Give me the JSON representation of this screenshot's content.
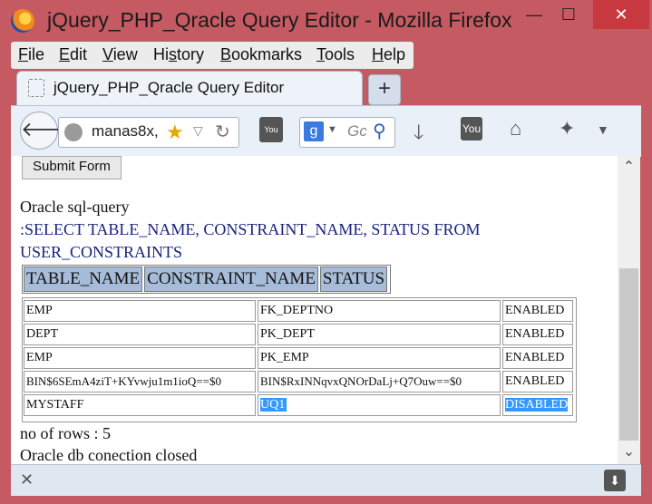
{
  "window": {
    "title": "jQuery_PHP_Qracle Query Editor - Mozilla Firefox",
    "minimize_glyph": "—",
    "maximize_glyph": "☐",
    "close_glyph": "✕"
  },
  "menubar": {
    "items": [
      {
        "accel": "F",
        "rest": "ile"
      },
      {
        "accel": "E",
        "rest": "dit"
      },
      {
        "accel": "V",
        "rest": "iew"
      },
      {
        "pre": "Hi",
        "accel": "s",
        "rest": "tory"
      },
      {
        "accel": "B",
        "rest": "ookmarks"
      },
      {
        "accel": "T",
        "rest": "ools"
      },
      {
        "accel": "H",
        "rest": "elp"
      }
    ]
  },
  "tabs": {
    "active_label": "jQuery_PHP_Qracle Query Editor",
    "new_tab_glyph": "+"
  },
  "navbar": {
    "back_glyph": "🡐",
    "url": "manas8x,",
    "search_engine": "g",
    "search_placeholder": "Gc",
    "icons": [
      "youtube-icon",
      "google-search-icon",
      "download-icon",
      "youtube-icon",
      "home-icon",
      "addon-icon",
      "menu-dropdown-icon"
    ]
  },
  "page": {
    "submit_label": "Submit Form",
    "query_heading": "Oracle sql-query",
    "query_line1": ":SELECT TABLE_NAME, CONSTRAINT_NAME, STATUS FROM",
    "query_line2": "USER_CONSTRAINTS",
    "headers": [
      "TABLE_NAME",
      "CONSTRAINT_NAME",
      "STATUS"
    ],
    "rows": [
      [
        "EMP",
        "FK_DEPTNO",
        "ENABLED"
      ],
      [
        "DEPT",
        "PK_DEPT",
        "ENABLED"
      ],
      [
        "EMP",
        "PK_EMP",
        "ENABLED"
      ],
      [
        "BIN$6SEmA4ziT+KYvwju1m1ioQ==$0",
        "BIN$RxINNqvxQNOrDaLj+Q7Ouw==$0",
        "ENABLED"
      ],
      [
        "MYSTAFF",
        "UQ1",
        "DISABLED"
      ]
    ],
    "row_count": "no of rows : 5",
    "closed_msg": "Oracle db conection closed"
  },
  "statusbar": {
    "close_glyph": "✕",
    "download_glyph": "⬇"
  },
  "colors": {
    "titlebar": "#c65a62",
    "header_cell": "#a7bcd8",
    "selection": "#3399ff",
    "query_text": "#1a237e"
  }
}
